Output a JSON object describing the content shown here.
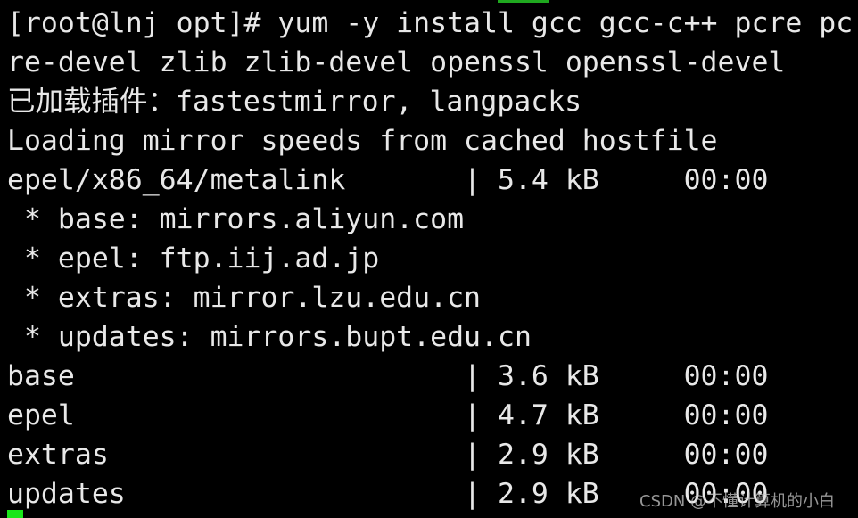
{
  "terminal": {
    "lines": [
      "[root@lnj opt]# yum -y install gcc gcc-c++ pcre pc",
      "re-devel zlib zlib-devel openssl openssl-devel",
      "已加载插件：fastestmirror, langpacks",
      "Loading mirror speeds from cached hostfile",
      "epel/x86_64/metalink       | 5.4 kB     00:00",
      " * base: mirrors.aliyun.com",
      " * epel: ftp.iij.ad.jp",
      " * extras: mirror.lzu.edu.cn",
      " * updates: mirrors.bupt.edu.cn",
      "base                       | 3.6 kB     00:00",
      "epel                       | 4.7 kB     00:00",
      "extras                     | 2.9 kB     00:00",
      "updates                    | 2.9 kB     00:00"
    ]
  },
  "watermark": "CSDN @不懂计算机的小白",
  "colors": {
    "background": "#000000",
    "text": "#e8e8e8",
    "cursor": "#19e619"
  }
}
